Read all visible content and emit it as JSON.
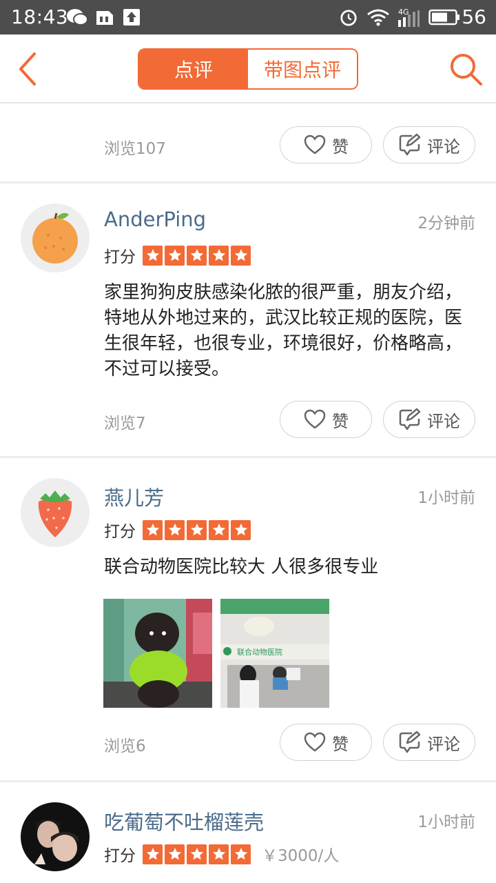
{
  "status_bar": {
    "time": "18:43",
    "network": "4G",
    "battery": "56"
  },
  "header": {
    "tabs": [
      {
        "label": "点评",
        "active": true
      },
      {
        "label": "带图点评",
        "active": false
      }
    ]
  },
  "colors": {
    "accent": "#f26a35",
    "name": "#4a6b8a",
    "muted": "#999999"
  },
  "actions": {
    "like_label": "赞",
    "comment_label": "评论"
  },
  "score_label": "打分",
  "reviews": [
    {
      "views": "浏览107"
    },
    {
      "name": "AnderPing",
      "time": "2分钟前",
      "rating": 5,
      "content": "家里狗狗皮肤感染化脓的很严重，朋友介绍，特地从外地过来的，武汉比较正规的医院，医生很年轻，也很专业，环境很好，价格略高，不过可以接受。",
      "views": "浏览7"
    },
    {
      "name": "燕儿芳",
      "time": "1小时前",
      "rating": 5,
      "content": "联合动物医院比较大 人很多很专业",
      "photo_text": "联合动物医院",
      "views": "浏览6"
    },
    {
      "name": "吃葡萄不吐榴莲壳",
      "time": "1小时前",
      "rating": 5,
      "price": "￥3000/人"
    }
  ]
}
